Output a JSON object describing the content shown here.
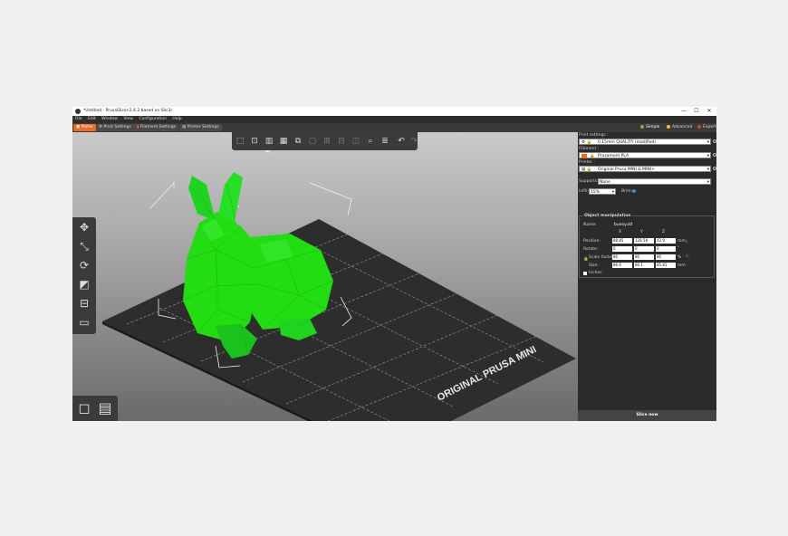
{
  "window": {
    "title": "*Untitled - PrusaSlicer-2.4.2 based on Slic3r",
    "controls": [
      "—",
      "☐",
      "✕"
    ]
  },
  "menu": [
    "File",
    "Edit",
    "Window",
    "View",
    "Configuration",
    "Help"
  ],
  "tabs": [
    {
      "label": "Plater",
      "icon": "plater-icon",
      "active": true
    },
    {
      "label": "Print Settings",
      "icon": "gear-icon",
      "active": false
    },
    {
      "label": "Filament Settings",
      "icon": "filament-icon",
      "active": false
    },
    {
      "label": "Printer Settings",
      "icon": "printer-icon",
      "active": false
    }
  ],
  "modes": {
    "simple": "Simple",
    "advanced": "Advanced",
    "expert": "Expert",
    "colors": {
      "simple": "#7cb342",
      "advanced": "#fbc02d",
      "expert": "#e53935"
    }
  },
  "viewport": {
    "bed_label": "ORIGINAL PRUSA MINI",
    "model_color": "#22dd11",
    "bed_color": "#2e2e2e"
  },
  "toolbar": {
    "top_icons": [
      "add-icon",
      "delete-icon",
      "delete-all-icon",
      "arrange-icon",
      "copy-icon",
      "paste-icon",
      "add-instance-icon",
      "remove-instance-icon",
      "split-icon",
      "search-icon",
      "layers-icon",
      "undo-icon",
      "redo-icon"
    ],
    "left_icons": [
      "move-icon",
      "scale-icon",
      "rotate-icon",
      "place-on-face-icon",
      "cut-icon",
      "layer-editing-icon"
    ]
  },
  "panel": {
    "print_settings_label": "Print settings :",
    "print_settings_value": "0.15mm QUALITY (modified)",
    "filament_label": "Filament :",
    "filament_value": "Prusament PLA",
    "filament_color": "#ed6b21",
    "printer_label": "Printer :",
    "printer_value": "Original Prusa MINI & MINI+",
    "supports_label": "Supports:",
    "supports_value": "None",
    "infill_label": "Infill:",
    "infill_value": "15%",
    "brim_label": "Brim:",
    "brim_checked": true,
    "object_manipulation": {
      "title": "Object manipulation",
      "name_label": "Name:",
      "name_value": "bunny.stl",
      "axes": [
        "X",
        "Y",
        "Z"
      ],
      "position_label": "Position:",
      "position": [
        "88.85",
        "128.58",
        "42.9"
      ],
      "position_unit": "mm",
      "rotate_label": "Rotate:",
      "rotate": [
        "0",
        "0",
        "0"
      ],
      "rotate_unit": "°",
      "scale_label": "Scale factors:",
      "scale": [
        "80",
        "80",
        "80"
      ],
      "scale_unit": "%",
      "size_label": "Size:",
      "size": [
        "86.6",
        "80.1",
        "85.81"
      ],
      "size_unit": "mm",
      "inches_label": "Inches"
    },
    "slice_button": "Slice now"
  }
}
